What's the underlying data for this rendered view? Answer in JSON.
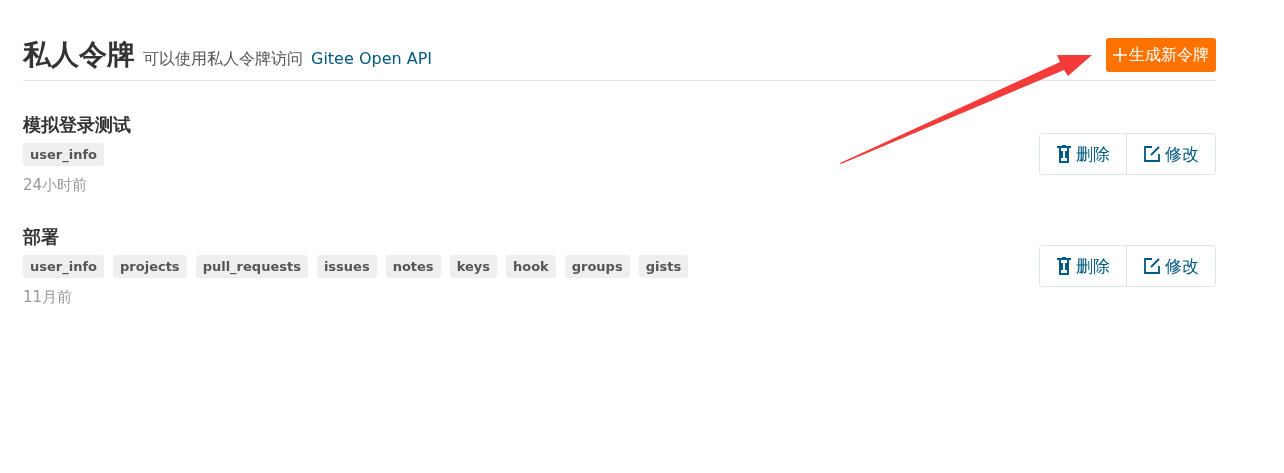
{
  "header": {
    "title": "私人令牌",
    "subtitle": "可以使用私人令牌访问",
    "link": "Gitee Open API",
    "button": "生成新令牌"
  },
  "tokens": [
    {
      "name": "模拟登录测试",
      "scopes": [
        "user_info"
      ],
      "time": "24小时前",
      "actions": [
        "删除",
        "修改"
      ]
    },
    {
      "name": "部署",
      "scopes": [
        "user_info",
        "projects",
        "pull_requests",
        "issues",
        "notes",
        "keys",
        "hook",
        "groups",
        "gists"
      ],
      "time": "11月前",
      "actions": [
        "删除",
        "修改"
      ]
    }
  ]
}
